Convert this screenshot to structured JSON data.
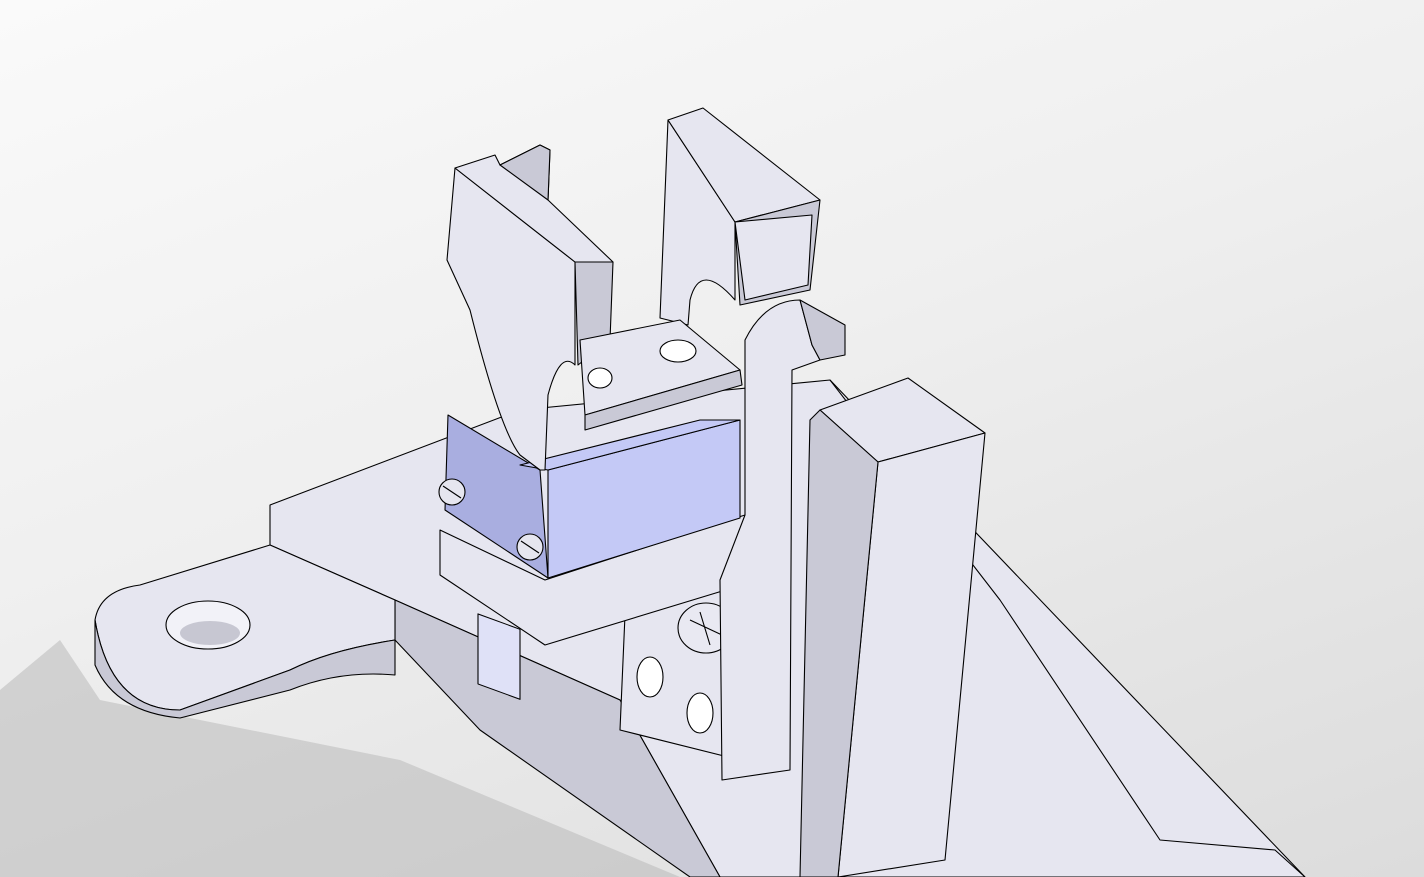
{
  "viewport": {
    "background_top": "#fafafa",
    "background_bottom": "#d8d8d8"
  },
  "model": {
    "part_color": "#e6e6f0",
    "part_shade": "#c9c9d6",
    "part_dark": "#b4b4c4",
    "servo_color": "#c4c9f6",
    "servo_dark": "#a9aee0",
    "edge_color": "#000000",
    "screw_icons": [
      "screw-head-icon",
      "screw-head-icon",
      "screw-head-icon"
    ]
  }
}
